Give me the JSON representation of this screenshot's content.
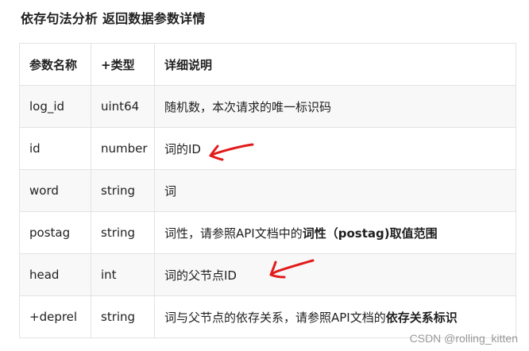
{
  "title": "依存句法分析 返回数据参数详情",
  "table": {
    "headers": [
      "参数名称",
      "+类型",
      "详细说明"
    ],
    "rows": [
      {
        "name": "log_id",
        "type": "uint64",
        "desc": "随机数，本次请求的唯一标识码",
        "desc_strong": ""
      },
      {
        "name": "id",
        "type": "number",
        "desc": "词的ID",
        "desc_strong": ""
      },
      {
        "name": "word",
        "type": "string",
        "desc": "词",
        "desc_strong": ""
      },
      {
        "name": "postag",
        "type": "string",
        "desc": "词性，请参照API文档中的",
        "desc_strong": "词性（postag)取值范围"
      },
      {
        "name": "head",
        "type": "int",
        "desc": "词的父节点ID",
        "desc_strong": ""
      },
      {
        "name": "+deprel",
        "type": "string",
        "desc": "词与父节点的依存关系，请参照API文档的",
        "desc_strong": "依存关系标识"
      }
    ]
  },
  "annotation_color": "#e21b1b",
  "watermark": "CSDN @rolling_kitten"
}
